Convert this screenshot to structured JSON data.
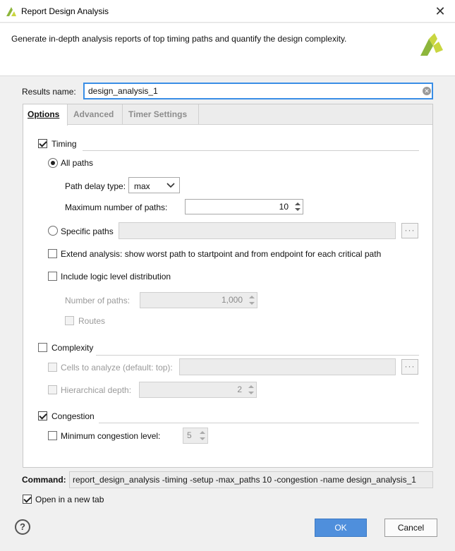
{
  "window": {
    "title": "Report Design Analysis",
    "close_glyph": "✕"
  },
  "header": {
    "description": "Generate in-depth analysis reports of top timing paths and quantify the design complexity."
  },
  "results_name": {
    "label": "Results name:",
    "value": "design_analysis_1"
  },
  "tabs": [
    {
      "label": "Options",
      "active": true
    },
    {
      "label": "Advanced",
      "active": false
    },
    {
      "label": "Timer Settings",
      "active": false
    }
  ],
  "timing": {
    "label": "Timing",
    "checked": true,
    "all_paths_label": "All paths",
    "path_delay_label": "Path delay type:",
    "path_delay_value": "max",
    "max_paths_label": "Maximum number of paths:",
    "max_paths_value": "10",
    "specific_paths_label": "Specific paths",
    "extend_label": "Extend analysis: show worst path to startpoint and from endpoint for each critical path",
    "logic_level_label": "Include logic level distribution",
    "num_paths_label": "Number of paths:",
    "num_paths_value": "1,000",
    "routes_label": "Routes"
  },
  "complexity": {
    "label": "Complexity",
    "checked": false,
    "cells_label": "Cells to analyze (default: top):",
    "hier_depth_label": "Hierarchical depth:",
    "hier_depth_value": "2"
  },
  "congestion": {
    "label": "Congestion",
    "checked": true,
    "min_level_label": "Minimum congestion level:",
    "min_level_value": "5"
  },
  "command": {
    "label": "Command:",
    "value": "report_design_analysis -timing -setup -max_paths 10 -congestion -name design_analysis_1"
  },
  "open_new_tab": {
    "label": "Open in a new tab",
    "checked": true
  },
  "buttons": {
    "ok": "OK",
    "cancel": "Cancel",
    "help": "?"
  },
  "colors": {
    "logo_green": "#8db63c",
    "logo_yellow": "#c9d640",
    "accent_blue": "#4f8fdc"
  }
}
